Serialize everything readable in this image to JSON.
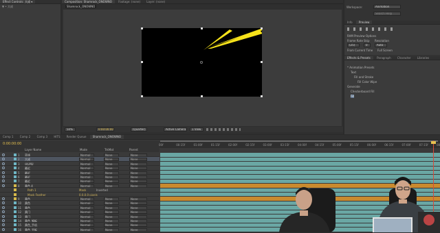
{
  "app": {
    "left_panel_tab": "Effect Controls: 大成 ▾",
    "left_panel_sub": "▼ • 大成",
    "comp_tab": "Composition: Shamrock_ONOWNO",
    "footage_tab": "Footage: (none)",
    "layer_tab": "Layer: (none)",
    "comp_breadcrumb": "Shamrock_ONOWNO",
    "workspace_label": "Workspace:",
    "workspace_value": "Animation",
    "search_placeholder": "Search Help"
  },
  "viewer_toolbar": {
    "zoom": "50%",
    "timecode": "0:00:00:00",
    "resolution": "(Quarter)",
    "camera": "Active Camera",
    "views": "1 View"
  },
  "preview_panel": {
    "tabs": [
      "Info",
      "Preview"
    ],
    "ram_options": "RAM Preview Options",
    "frame_rate_label": "Frame Rate",
    "skip_label": "Skip",
    "resolution_label": "Resolution",
    "frame_rate_value": "(25)",
    "skip_value": "0",
    "resolution_value": "Auto",
    "from_current": "From Current Time",
    "full_screen": "Full Screen"
  },
  "effects_panel": {
    "tabs": [
      "Effects & Presets",
      "Paragraph",
      "Character",
      "Libraries"
    ],
    "tree": [
      {
        "label": "* Animation Presets",
        "indent": 0
      },
      {
        "label": "Text",
        "indent": 1
      },
      {
        "label": "Fill and Stroke",
        "indent": 2
      },
      {
        "label": "Fill Color Wipe",
        "indent": 3
      },
      {
        "label": "Generate",
        "indent": 0
      },
      {
        "label": "Checkerboard Fill",
        "indent": 1
      },
      {
        "label": "Fill",
        "indent": 1
      }
    ]
  },
  "timeline": {
    "tabs": [
      "Comp 1",
      "Comp 2",
      "Comp 3",
      "HITS",
      "Render Queue",
      "Shamrock_ONOWNO"
    ],
    "timecode": "0:00:00:00",
    "search_placeholder": "",
    "columns": {
      "name": "Layer Name",
      "mode": "Mode",
      "trkmat": "TrkMat",
      "parent": "Parent"
    },
    "ruler_labels": [
      "00f",
      "00:15f",
      "01:00f",
      "01:15f",
      "02:00f",
      "02:15f",
      "03:00f",
      "03:15f",
      "04:00f",
      "04:15f",
      "05:00f",
      "05:15f",
      "06:00f",
      "06:15f",
      "07:00f",
      "07:15f",
      "08:00f"
    ],
    "layers": [
      {
        "num": "1",
        "name": "蓝线",
        "mode": "Normal",
        "trk": "None",
        "parent": "None",
        "color": "#6fb6c4",
        "track": "#6aa7a4"
      },
      {
        "num": "2",
        "name": "大成",
        "mode": "Normal",
        "trk": "None",
        "parent": "None",
        "color": "#6fb6c4",
        "track": "#6aa7a4"
      },
      {
        "num": "3",
        "name": "化LMU",
        "mode": "Normal",
        "trk": "None",
        "parent": "None",
        "color": "#6fb6c4",
        "track": "#6aa7a4"
      },
      {
        "num": "4",
        "name": "最近",
        "mode": "Normal",
        "trk": "None",
        "parent": "None",
        "color": "#6fb6c4",
        "track": "#6aa7a4"
      },
      {
        "num": "5",
        "name": "最近",
        "mode": "Normal",
        "trk": "None",
        "parent": "None",
        "color": "#6fb6c4",
        "track": "#6aa7a4"
      },
      {
        "num": "6",
        "name": "最近",
        "mode": "Normal",
        "trk": "None",
        "parent": "None",
        "color": "#6fb6c4",
        "track": "#6aa7a4"
      },
      {
        "num": "7",
        "name": "最近",
        "mode": "Normal",
        "trk": "None",
        "parent": "None",
        "color": "#6fb6c4",
        "track": "#6aa7a4"
      },
      {
        "num": "8",
        "name": "黄色 4",
        "mode": "Normal",
        "trk": "None",
        "parent": "None",
        "color": "#d6b94a",
        "track": "#c98a2e"
      },
      {
        "num": "",
        "name": "Path 1",
        "mode": "Mask",
        "trk": "Inverted",
        "parent": "",
        "color": "#d6b94a",
        "track": "#6aa7a4",
        "sub": true
      },
      {
        "num": "",
        "name": "Mask Feather",
        "mode": "0.0,0.0 pixels",
        "trk": "",
        "parent": "",
        "color": "#d6b94a",
        "track": "#6aa7a4",
        "sub": true
      },
      {
        "num": "9",
        "name": "黄色",
        "mode": "Normal",
        "trk": "None",
        "parent": "None",
        "color": "#d6b94a",
        "track": "#c98a2e"
      },
      {
        "num": "10",
        "name": "黄色",
        "mode": "Normal",
        "trk": "None",
        "parent": "None",
        "color": "#6fb6c4",
        "track": "#6aa7a4"
      },
      {
        "num": "11",
        "name": "黄色",
        "mode": "Normal",
        "trk": "None",
        "parent": "None",
        "color": "#6fb6c4",
        "track": "#6aa7a4"
      },
      {
        "num": "12",
        "name": "黄门",
        "mode": "Normal",
        "trk": "None",
        "parent": "None",
        "color": "#6fb6c4",
        "track": "#6aa7a4"
      },
      {
        "num": "13",
        "name": "黄门",
        "mode": "Normal",
        "trk": "None",
        "parent": "None",
        "color": "#6fb6c4",
        "track": "#6aa7a4"
      },
      {
        "num": "14",
        "name": "黄色_钢板",
        "mode": "Normal",
        "trk": "None",
        "parent": "None",
        "color": "#6fb6c4",
        "track": "#6aa7a4"
      },
      {
        "num": "15",
        "name": "黄色_手机",
        "mode": "Normal",
        "trk": "None",
        "parent": "None",
        "color": "#6fb6c4",
        "track": "#6aa7a4"
      },
      {
        "num": "16",
        "name": "黄色_平板",
        "mode": "Normal",
        "trk": "None",
        "parent": "None",
        "color": "#6fb6c4",
        "track": "#6aa7a4"
      }
    ]
  }
}
